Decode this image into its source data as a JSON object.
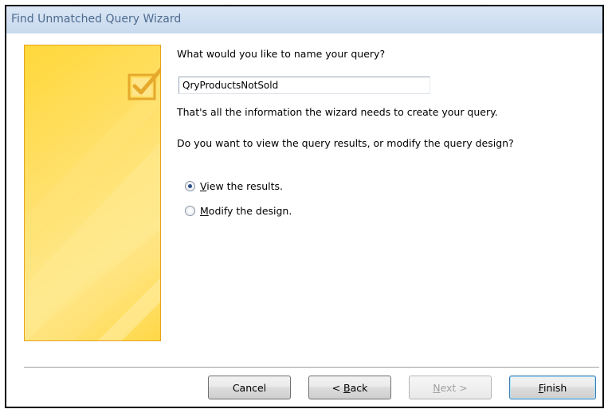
{
  "window": {
    "title": "Find Unmatched Query Wizard"
  },
  "content": {
    "name_prompt": "What would you like to name your query?",
    "query_name_value": "QryProductsNotSold",
    "info_text": "That's all the information the wizard needs to create your query.",
    "choice_prompt": "Do you want to view the query results, or modify the query design?"
  },
  "options": [
    {
      "mnemonic": "V",
      "rest": "iew the results.",
      "selected": true
    },
    {
      "mnemonic": "M",
      "rest": "odify the design.",
      "selected": false
    }
  ],
  "buttons": {
    "cancel": {
      "label": "Cancel"
    },
    "back": {
      "prefix": "< ",
      "mnemonic": "B",
      "rest": "ack"
    },
    "next": {
      "mnemonic": "N",
      "rest": "ext >",
      "enabled": false
    },
    "finish": {
      "mnemonic": "F",
      "rest": "inish"
    }
  },
  "colors": {
    "banner_yellow": "#ffd83a",
    "banner_border": "#e7a31e",
    "title_text": "#4d6b8f",
    "titlebar": "#c8d9ee"
  },
  "icons": {
    "banner": "checkmark-box-icon"
  }
}
